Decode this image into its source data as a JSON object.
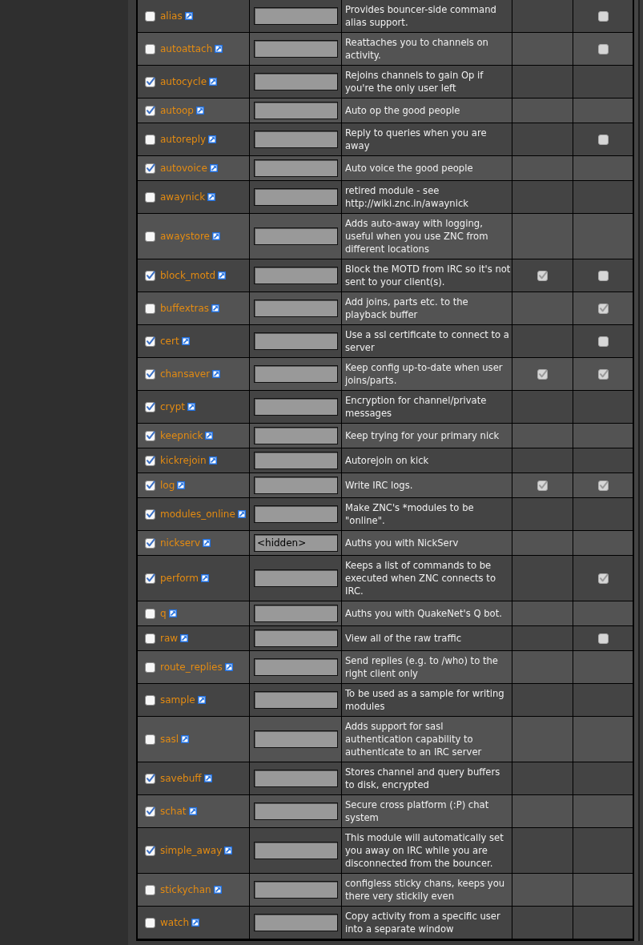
{
  "table": {
    "rows": [
      {
        "name": "alias",
        "checked": false,
        "description": "Provides bouncer-side command alias support.",
        "column_5": {
          "checked": false,
          "disabled": true
        }
      },
      {
        "name": "autoattach",
        "checked": false,
        "description": "Reattaches you to channels on activity.",
        "column_5": {
          "checked": false,
          "disabled": true
        }
      },
      {
        "name": "autocycle",
        "checked": true,
        "description": "Rejoins channels to gain Op if you're the only user left"
      },
      {
        "name": "autoop",
        "checked": true,
        "description": "Auto op the good people"
      },
      {
        "name": "autoreply",
        "checked": false,
        "description": "Reply to queries when you are away",
        "column_5": {
          "checked": false,
          "disabled": true
        }
      },
      {
        "name": "autovoice",
        "checked": true,
        "description": "Auto voice the good people"
      },
      {
        "name": "awaynick",
        "checked": false,
        "description": "retired module - see http://wiki.znc.in/awaynick"
      },
      {
        "name": "awaystore",
        "checked": false,
        "description": "Adds auto-away with logging, useful when you use ZNC from different locations"
      },
      {
        "name": "block_motd",
        "checked": true,
        "description": "Block the MOTD from IRC so it's not sent to your client(s).",
        "column_4": {
          "checked": true,
          "disabled": true
        },
        "column_5": {
          "checked": false,
          "disabled": true
        }
      },
      {
        "name": "buffextras",
        "checked": false,
        "description": "Add joins, parts etc. to the playback buffer",
        "column_5": {
          "checked": true,
          "disabled": true
        }
      },
      {
        "name": "cert",
        "checked": true,
        "description": "Use a ssl certificate to connect to a server",
        "column_5": {
          "checked": false,
          "disabled": true
        }
      },
      {
        "name": "chansaver",
        "checked": true,
        "description": "Keep config up-to-date when user joins/parts.",
        "column_4": {
          "checked": true,
          "disabled": true
        },
        "column_5": {
          "checked": true,
          "disabled": true
        }
      },
      {
        "name": "crypt",
        "checked": true,
        "description": "Encryption for channel/private messages"
      },
      {
        "name": "keepnick",
        "checked": true,
        "description": "Keep trying for your primary nick"
      },
      {
        "name": "kickrejoin",
        "checked": true,
        "description": "Autorejoin on kick"
      },
      {
        "name": "log",
        "checked": true,
        "description": "Write IRC logs.",
        "column_4": {
          "checked": true,
          "disabled": true
        },
        "column_5": {
          "checked": true,
          "disabled": true
        }
      },
      {
        "name": "modules_online",
        "checked": true,
        "description": "Make ZNC's *modules to be \"online\"."
      },
      {
        "name": "nickserv",
        "checked": true,
        "argument": "<hidden>",
        "description": "Auths you with NickServ"
      },
      {
        "name": "perform",
        "checked": true,
        "description": "Keeps a list of commands to be executed when ZNC connects to IRC.",
        "column_5": {
          "checked": true,
          "disabled": true
        }
      },
      {
        "name": "q",
        "checked": false,
        "description": "Auths you with QuakeNet's Q bot."
      },
      {
        "name": "raw",
        "checked": false,
        "description": "View all of the raw traffic",
        "column_5": {
          "checked": false,
          "disabled": true
        }
      },
      {
        "name": "route_replies",
        "checked": false,
        "description": "Send replies (e.g. to /who) to the right client only"
      },
      {
        "name": "sample",
        "checked": false,
        "description": "To be used as a sample for writing modules"
      },
      {
        "name": "sasl",
        "checked": false,
        "description": "Adds support for sasl authentication capability to authenticate to an IRC server"
      },
      {
        "name": "savebuff",
        "checked": true,
        "description": "Stores channel and query buffers to disk, encrypted"
      },
      {
        "name": "schat",
        "checked": true,
        "description": "Secure cross platform (:P) chat system"
      },
      {
        "name": "simple_away",
        "checked": true,
        "description": "This module will automatically set you away on IRC while you are disconnected from the bouncer."
      },
      {
        "name": "stickychan",
        "checked": false,
        "description": "configless sticky chans, keeps you there very stickily even"
      },
      {
        "name": "watch",
        "checked": false,
        "description": "Copy activity from a specific user into a separate window"
      }
    ]
  }
}
